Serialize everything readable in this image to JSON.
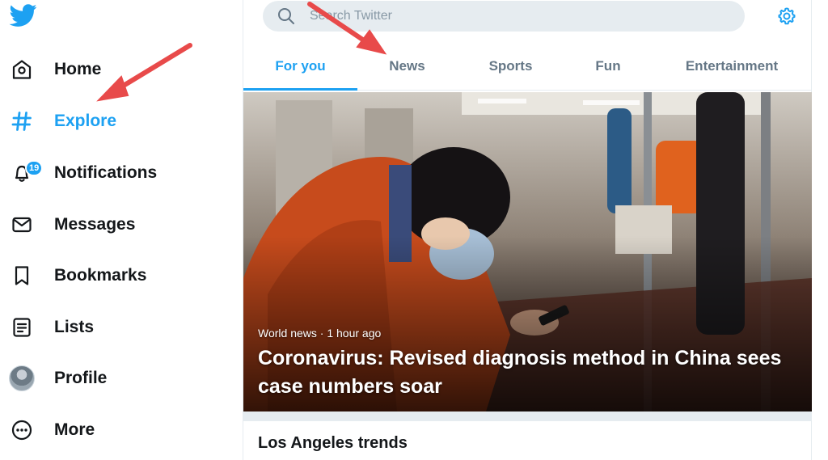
{
  "colors": {
    "accent": "#1da1f2",
    "text_primary": "#14171a",
    "text_secondary": "#657786",
    "arrow": "#e84a4a"
  },
  "sidebar": {
    "logo_icon": "twitter-bird-icon",
    "items": [
      {
        "label": "Home",
        "icon": "home-icon"
      },
      {
        "label": "Explore",
        "icon": "hashtag-icon"
      },
      {
        "label": "Notifications",
        "icon": "bell-icon",
        "badge": "19"
      },
      {
        "label": "Messages",
        "icon": "envelope-icon"
      },
      {
        "label": "Bookmarks",
        "icon": "bookmark-icon"
      },
      {
        "label": "Lists",
        "icon": "list-icon"
      },
      {
        "label": "Profile",
        "icon": "avatar"
      },
      {
        "label": "More",
        "icon": "more-circle-icon"
      }
    ]
  },
  "search": {
    "placeholder": "Search Twitter",
    "value": ""
  },
  "tabs": [
    {
      "label": "For you",
      "active": true
    },
    {
      "label": "News",
      "active": false
    },
    {
      "label": "Sports",
      "active": false
    },
    {
      "label": "Fun",
      "active": false
    },
    {
      "label": "Entertainment",
      "active": false
    }
  ],
  "hero": {
    "meta": "World news · 1 hour ago",
    "title": "Coronavirus: Revised diagnosis method in China sees case numbers soar"
  },
  "trends": {
    "title": "Los Angeles trends"
  }
}
